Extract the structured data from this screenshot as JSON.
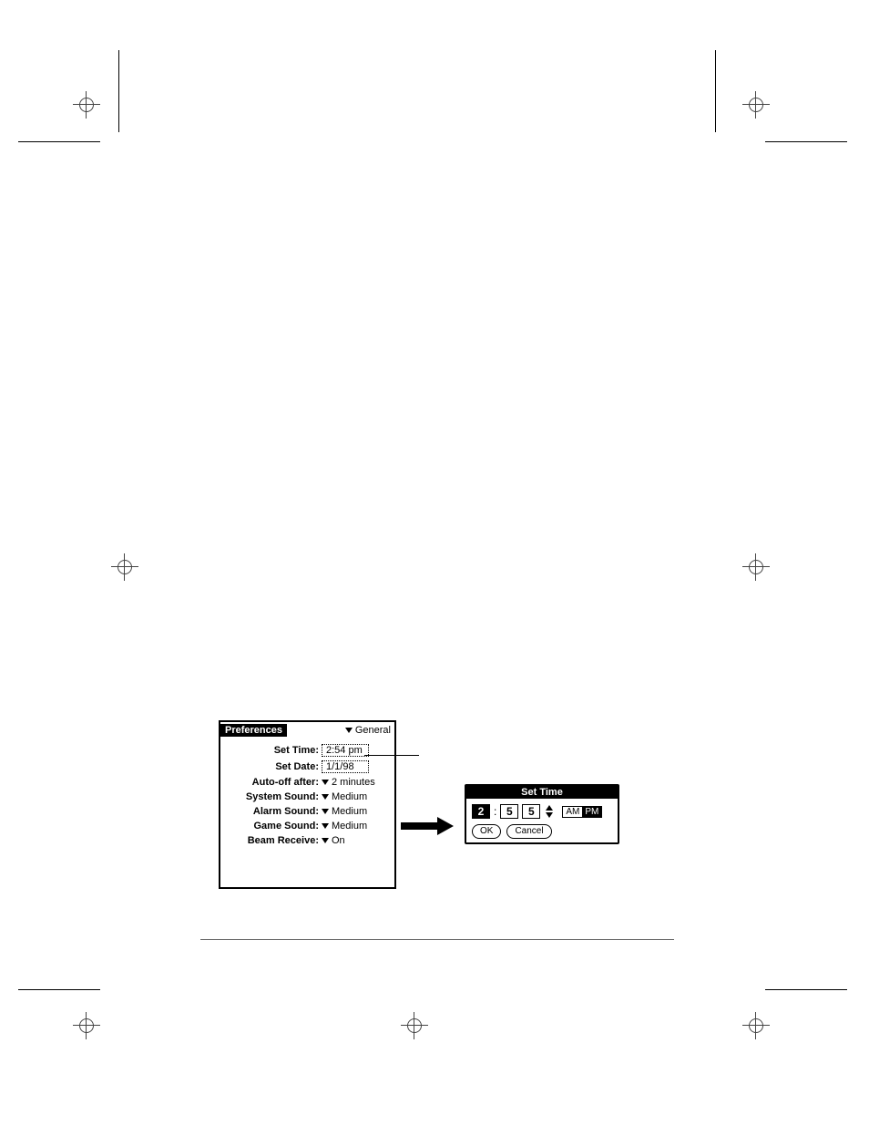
{
  "preferences": {
    "title": "Preferences",
    "category": "General",
    "rows": {
      "set_time": {
        "label": "Set Time:",
        "value": "2:54 pm",
        "type": "box"
      },
      "set_date": {
        "label": "Set Date:",
        "value": "1/1/98",
        "type": "box"
      },
      "auto_off": {
        "label": "Auto-off after:",
        "value": "2 minutes",
        "type": "drop"
      },
      "sys_sound": {
        "label": "System Sound:",
        "value": "Medium",
        "type": "drop"
      },
      "alarm_sound": {
        "label": "Alarm Sound:",
        "value": "Medium",
        "type": "drop"
      },
      "game_sound": {
        "label": "Game Sound:",
        "value": "Medium",
        "type": "drop"
      },
      "beam_recv": {
        "label": "Beam Receive:",
        "value": "On",
        "type": "drop"
      }
    }
  },
  "set_time_dialog": {
    "title": "Set Time",
    "hour": "2",
    "min_tens": "5",
    "min_ones": "5",
    "colon": ":",
    "am": "AM",
    "pm": "PM",
    "selected_period": "PM",
    "ok": "OK",
    "cancel": "Cancel"
  }
}
